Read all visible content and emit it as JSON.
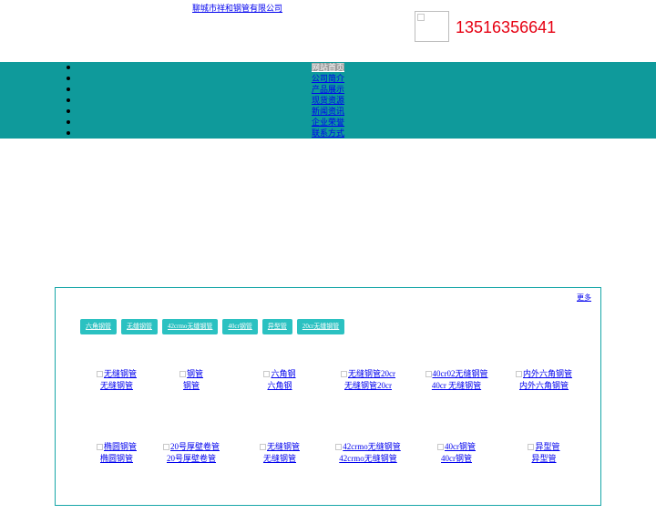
{
  "header": {
    "site_name": "聊城市祥和钢管有限公司",
    "phone": "13516356641"
  },
  "nav": {
    "items": [
      {
        "label": "网站首页",
        "active": true
      },
      {
        "label": "公司简介",
        "active": false
      },
      {
        "label": "产品展示",
        "active": false
      },
      {
        "label": "现货资源",
        "active": false
      },
      {
        "label": "新闻资讯",
        "active": false
      },
      {
        "label": "企业荣誉",
        "active": false
      },
      {
        "label": "联系方式",
        "active": false
      }
    ]
  },
  "products": {
    "more_label": "更多",
    "tabs": [
      "六角钢管",
      "无缝钢管",
      "42crmo无缝钢管",
      "40cr钢管",
      "异型管",
      "20cr无缝钢管"
    ],
    "items": [
      {
        "alt": "无缝钢管",
        "caption": "无缝钢管"
      },
      {
        "alt": "钢管",
        "caption": "钢管"
      },
      {
        "alt": "六角钢",
        "caption": "六角钢"
      },
      {
        "alt": "无缝钢管20cr",
        "caption": "无缝钢管20cr"
      },
      {
        "alt": "40cr02无缝钢管",
        "caption": "40cr 无缝钢管"
      },
      {
        "alt": "内外六角钢管",
        "caption": "内外六角钢管"
      },
      {
        "alt": "椭圆钢管",
        "caption": "椭圆钢管"
      },
      {
        "alt": "20号厚壁卷管",
        "caption": "20号厚壁卷管"
      },
      {
        "alt": "无缝钢管",
        "caption": "无缝钢管"
      },
      {
        "alt": "42crmo无缝钢管",
        "caption": "42crmo无缝钢管"
      },
      {
        "alt": "40cr钢管",
        "caption": "40cr钢管"
      },
      {
        "alt": "异型管",
        "caption": "异型管"
      }
    ]
  }
}
